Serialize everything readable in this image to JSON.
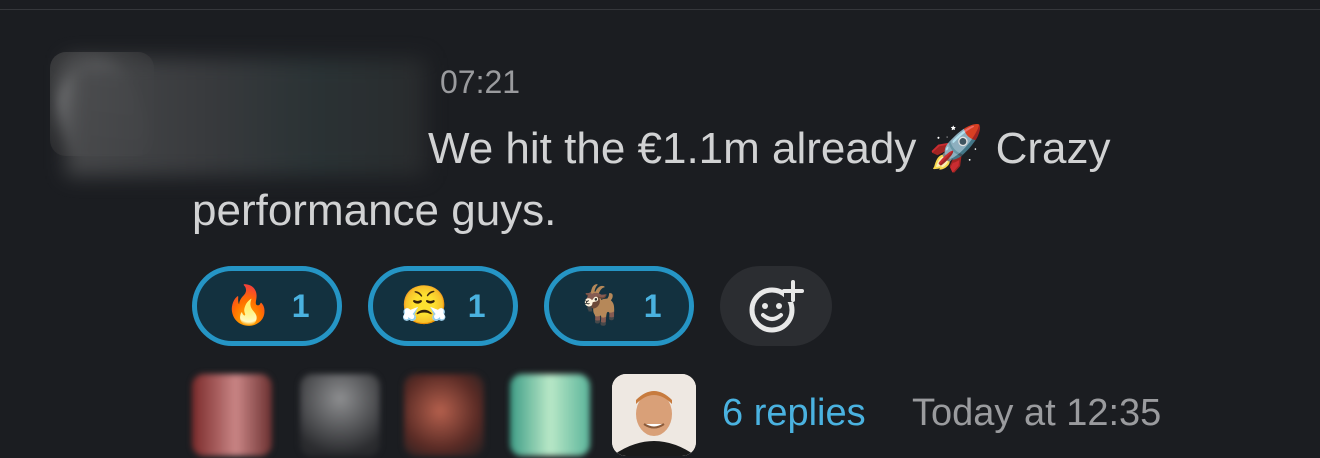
{
  "message": {
    "timestamp": "07:21",
    "text_part1": "We hit the €1.1m already ",
    "emoji": "🚀",
    "text_part2": " Crazy performance guys."
  },
  "reactions": [
    {
      "emoji": "🔥",
      "name": "fire",
      "count": "1"
    },
    {
      "emoji": "😤",
      "name": "triumph",
      "count": "1"
    },
    {
      "emoji": "🐐",
      "name": "goat",
      "count": "1"
    }
  ],
  "add_reaction_icon": "add-emoji-icon",
  "thread": {
    "replies_label": "6 replies",
    "last_reply": "Today at 12:35"
  },
  "colors": {
    "background": "#1b1d21",
    "accent": "#4ab2e0",
    "reaction_border": "#2595c5"
  }
}
